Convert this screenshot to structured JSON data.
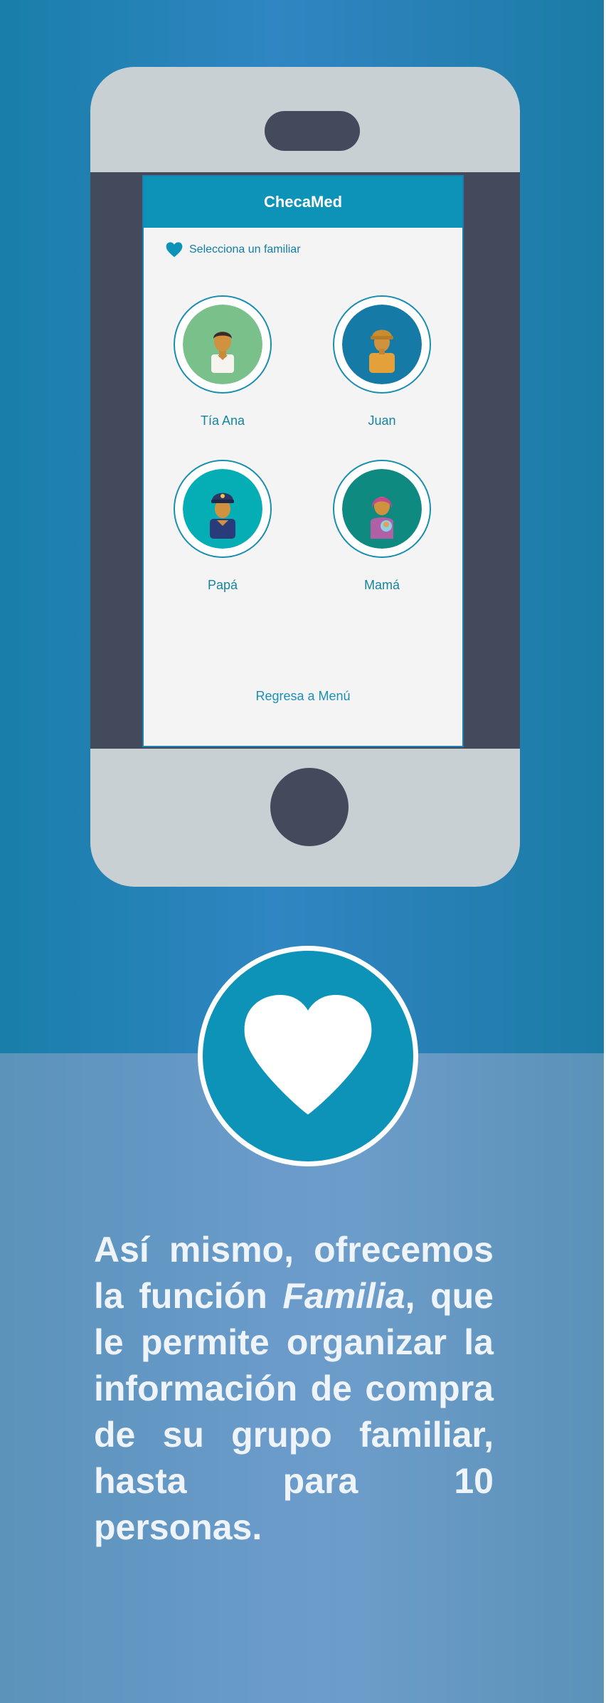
{
  "app": {
    "title": "ChecaMed",
    "subheader_icon": "heart-icon",
    "subheader_text": "Selecciona un familiar",
    "back_link": "Regresa a Menú"
  },
  "family_members": [
    {
      "name": "Tía Ana",
      "avatar": "person-avatar",
      "circle_color": "#79c08b"
    },
    {
      "name": "Juan",
      "avatar": "worker-avatar",
      "circle_color": "#167aa6"
    },
    {
      "name": "Papá",
      "avatar": "police-avatar",
      "circle_color": "#05aeb4"
    },
    {
      "name": "Mamá",
      "avatar": "mother-baby-avatar",
      "circle_color": "#0f8a80"
    }
  ],
  "badge_icon": "heart-icon",
  "description": {
    "part1": "Así mismo, ofrecemos la función ",
    "emphasis": "Familia",
    "part2": ", que le permite organizar la información de compra de su grupo familiar, hasta para 10 personas."
  },
  "colors": {
    "brand": "#0e93b8",
    "phone_body": "#c9d0d3",
    "phone_dark": "#424a5b",
    "screen_bg": "#f4f4f5",
    "text_accent": "#15859f"
  }
}
